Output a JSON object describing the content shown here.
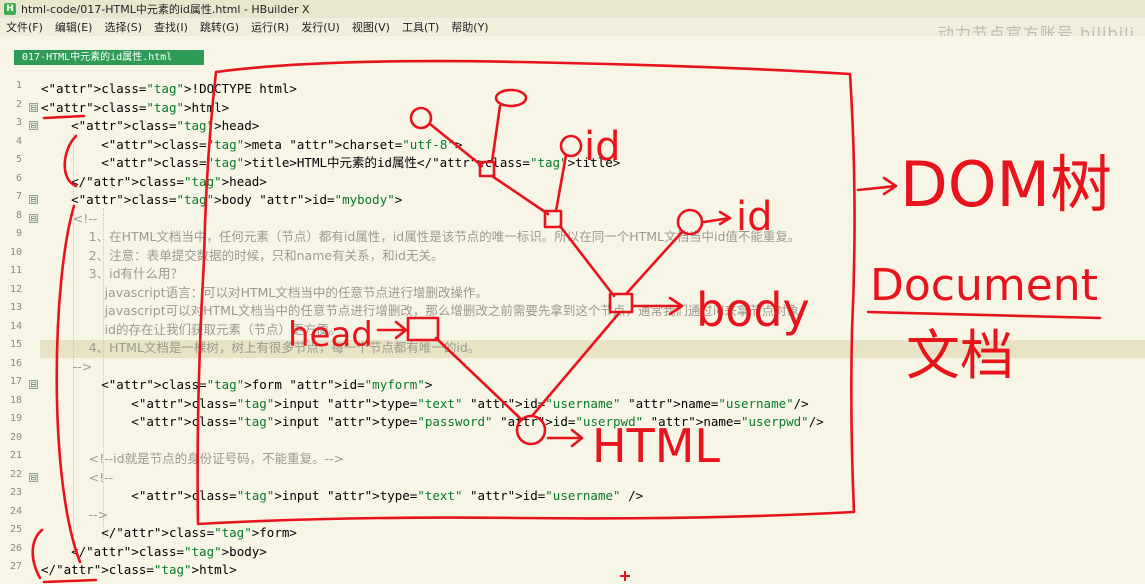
{
  "window": {
    "title": "html-code/017-HTML中元素的id属性.html - HBuilder X",
    "watermark": "动力节点官方账号 bilibili"
  },
  "menu": [
    "文件(F)",
    "编辑(E)",
    "选择(S)",
    "查找(I)",
    "跳转(G)",
    "运行(R)",
    "发行(U)",
    "视图(V)",
    "工具(T)",
    "帮助(Y)"
  ],
  "tab": {
    "label": "017-HTML中元素的id属性.html"
  },
  "editor": {
    "current_line": 15,
    "lines": [
      {
        "n": "1",
        "fold": "",
        "t": "<!DOCTYPE html>"
      },
      {
        "n": "2",
        "fold": "⊟",
        "t": "<html>"
      },
      {
        "n": "3",
        "fold": "⊟",
        "t": "    <head>"
      },
      {
        "n": "4",
        "fold": "",
        "t": "        <meta charset=\"utf-8\">"
      },
      {
        "n": "5",
        "fold": "",
        "t": "        <title>HTML中元素的id属性</title>"
      },
      {
        "n": "6",
        "fold": "",
        "t": "    </head>"
      },
      {
        "n": "7",
        "fold": "⊟",
        "t": "    <body id=\"mybody\">"
      },
      {
        "n": "8",
        "fold": "⊟",
        "t": "        <!--"
      },
      {
        "n": "9",
        "fold": "",
        "t": "            1、在HTML文档当中，任何元素（节点）都有id属性，id属性是该节点的唯一标识。所以在同一个HTML文档当中id值不能重复。"
      },
      {
        "n": "10",
        "fold": "",
        "t": "            2、注意：表单提交数据的时候，只和name有关系，和id无关。"
      },
      {
        "n": "11",
        "fold": "",
        "t": "            3、id有什么用？"
      },
      {
        "n": "12",
        "fold": "",
        "t": "                javascript语言：可以对HTML文档当中的任意节点进行增删改操作。"
      },
      {
        "n": "13",
        "fold": "",
        "t": "                javascript可以对HTML文档当中的任意节点进行增删改，那么增删改之前需要先拿到这个节点，通常我们通过id来拿节点对象。"
      },
      {
        "n": "14",
        "fold": "",
        "t": "                id的存在让我们获取元素（节点）更方便。"
      },
      {
        "n": "15",
        "fold": "",
        "t": "            4、HTML文档是一棵树，树上有很多节点，每一个节点都有唯一的id。"
      },
      {
        "n": "16",
        "fold": "",
        "t": "        -->"
      },
      {
        "n": "17",
        "fold": "⊟",
        "t": "        <form id=\"myform\">"
      },
      {
        "n": "18",
        "fold": "",
        "t": "            <input type=\"text\" id=\"username\" name=\"username\"/>"
      },
      {
        "n": "19",
        "fold": "",
        "t": "            <input type=\"password\" id=\"userpwd\" name=\"userpwd\"/>"
      },
      {
        "n": "20",
        "fold": "",
        "t": ""
      },
      {
        "n": "21",
        "fold": "",
        "t": "            <!--id就是节点的身份证号码，不能重复。-->"
      },
      {
        "n": "22",
        "fold": "⊟",
        "t": "            <!--"
      },
      {
        "n": "23",
        "fold": "",
        "t": "            <input type=\"text\" id=\"username\" />"
      },
      {
        "n": "24",
        "fold": "",
        "t": "            -->"
      },
      {
        "n": "25",
        "fold": "",
        "t": "        </form>"
      },
      {
        "n": "26",
        "fold": "",
        "t": "    </body>"
      },
      {
        "n": "27",
        "fold": "",
        "t": "</html>"
      }
    ]
  },
  "annotations": {
    "color": "#e8141b",
    "labels": [
      "id",
      "id",
      "body",
      "head",
      "HTML",
      "DOM树",
      "Document",
      "文档"
    ]
  }
}
